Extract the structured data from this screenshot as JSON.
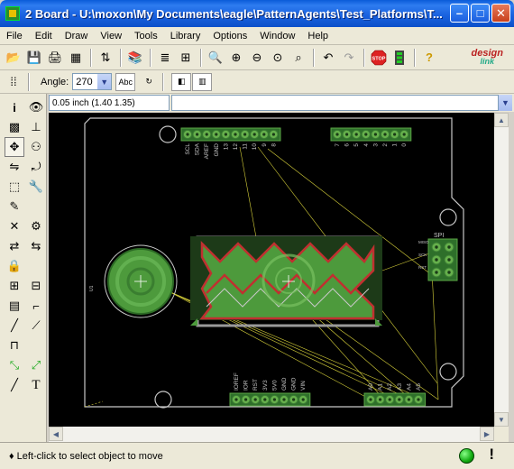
{
  "window": {
    "title": "2 Board - U:\\moxon\\My Documents\\eagle\\PatternAgents\\Test_Platforms\\T..."
  },
  "menu": [
    "File",
    "Edit",
    "Draw",
    "View",
    "Tools",
    "Library",
    "Options",
    "Window",
    "Help"
  ],
  "toolbar": {
    "angle_label": "Angle:",
    "angle_value": "270",
    "brand_top": "design",
    "brand_bottom": "link"
  },
  "coord": {
    "readout": "0.05 inch (1.40 1.35)",
    "command": ""
  },
  "status": {
    "message": "Left-click to select object to move"
  },
  "board": {
    "top_header_labels": [
      "SCL",
      "SDA",
      "AREF",
      "GND",
      "13",
      "12",
      "11",
      "10",
      "9",
      "8"
    ],
    "top_header_labels2": [
      "7",
      "6",
      "5",
      "4",
      "3",
      "2",
      "1",
      "0"
    ],
    "bottom_header_labels": [
      "IOREF",
      "IOR",
      "RST",
      "3V3",
      "5V0",
      "GND",
      "GND",
      "VIN"
    ],
    "bottom_header_labels2": [
      "A0",
      "A1",
      "A2",
      "A3",
      "A4",
      "A5"
    ],
    "spi_label": "SPI",
    "spi_pins": [
      "MISO",
      "SCK",
      "RST"
    ]
  },
  "colors": {
    "board_outline": "#c8c8c8",
    "copper": "#4d9a3c",
    "pad": "#66b04c",
    "airwire": "#d8d23a",
    "silk": "#c8c8c8",
    "keepout": "#c03030"
  }
}
